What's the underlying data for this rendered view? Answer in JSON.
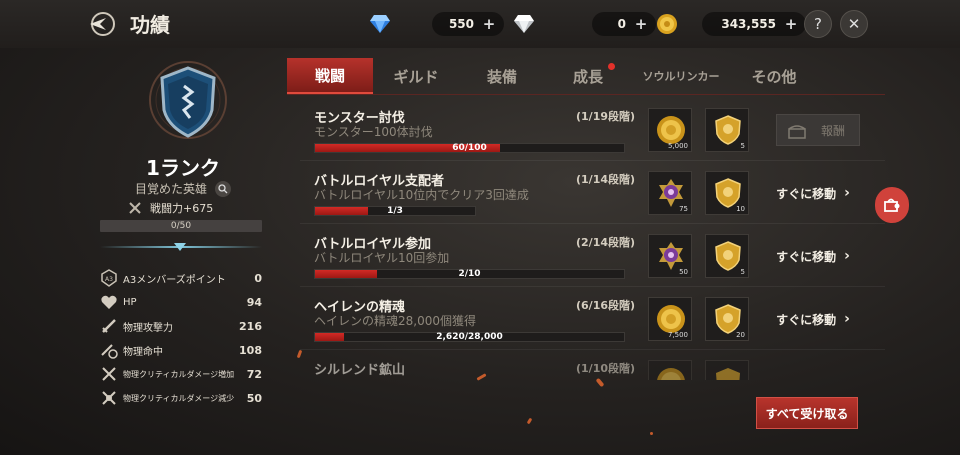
{
  "header": {
    "title": "功績",
    "currencies": [
      {
        "icon": "blue-gem-icon",
        "value": "550"
      },
      {
        "icon": "white-gem-icon",
        "value": "0"
      },
      {
        "icon": "gold-coin-icon",
        "value": "343,555"
      }
    ],
    "help_label": "?",
    "close_label": "✕"
  },
  "profile": {
    "rank": "1ランク",
    "title": "目覚めた英雄",
    "power": "戦闘力+675",
    "exp_progress": "0/50",
    "exp_fraction": 0,
    "stats": [
      {
        "icon": "a3-points-icon",
        "label": "A3メンバーズポイント",
        "value": "0"
      },
      {
        "icon": "heart-icon",
        "label": "HP",
        "value": "94"
      },
      {
        "icon": "sword-icon",
        "label": "物理攻撃力",
        "value": "216"
      },
      {
        "icon": "sword-target-icon",
        "label": "物理命中",
        "value": "108"
      },
      {
        "icon": "crossed-swords-icon",
        "label": "物理クリティカルダメージ増加",
        "value": "72"
      },
      {
        "icon": "crossed-swords-shield-icon",
        "label": "物理クリティカルダメージ減少",
        "value": "50"
      }
    ]
  },
  "tabs": [
    {
      "label": "戦闘",
      "active": true
    },
    {
      "label": "ギルド"
    },
    {
      "label": "装備"
    },
    {
      "label": "成長",
      "notification": true
    },
    {
      "label": "ソウルリンカー"
    },
    {
      "label": "その他"
    }
  ],
  "achievements": [
    {
      "title": "モンスター討伐",
      "stage": "(1/19段階)",
      "desc": "モンスター100体討伐",
      "progress_text": "60/100",
      "progress": 0.6,
      "rewards": [
        {
          "icon": "gold-coin-icon",
          "qty": "5,000"
        },
        {
          "icon": "gold-shield-icon",
          "qty": "5"
        }
      ],
      "action": "報酬",
      "action_type": "claim"
    },
    {
      "title": "バトルロイヤル支配者",
      "stage": "(1/14段階)",
      "desc": "バトルロイヤル10位内でクリア3回達成",
      "progress_text": "1/3",
      "progress": 0.333,
      "rewards": [
        {
          "icon": "purple-medal-icon",
          "qty": "75"
        },
        {
          "icon": "gold-shield-icon",
          "qty": "10"
        }
      ],
      "action": "すぐに移動",
      "action_type": "move"
    },
    {
      "title": "バトルロイヤル参加",
      "stage": "(2/14段階)",
      "desc": "バトルロイヤル10回参加",
      "progress_text": "2/10",
      "progress": 0.2,
      "rewards": [
        {
          "icon": "purple-medal-icon",
          "qty": "50"
        },
        {
          "icon": "gold-shield-icon",
          "qty": "5"
        }
      ],
      "action": "すぐに移動",
      "action_type": "move"
    },
    {
      "title": "ヘイレンの精魂",
      "stage": "(6/16段階)",
      "desc": "ヘイレンの精魂28,000個獲得",
      "progress_text": "2,620/28,000",
      "progress": 0.094,
      "rewards": [
        {
          "icon": "gold-coin-icon",
          "qty": "7,500"
        },
        {
          "icon": "gold-shield-icon",
          "qty": "20"
        }
      ],
      "action": "すぐに移動",
      "action_type": "move"
    },
    {
      "title": "シルレンド鉱山",
      "stage": "(1/10段階)",
      "desc": "",
      "progress_text": "",
      "progress": 0,
      "rewards": [
        {
          "icon": "gold-coin-icon",
          "qty": ""
        },
        {
          "icon": "gold-shield-icon",
          "qty": ""
        }
      ],
      "action": "",
      "action_type": "move"
    }
  ],
  "receive_all_label": "すべて受け取る",
  "colors": {
    "accent": "#b6322b",
    "progress": "#d22a25",
    "bg": "#24211f"
  }
}
